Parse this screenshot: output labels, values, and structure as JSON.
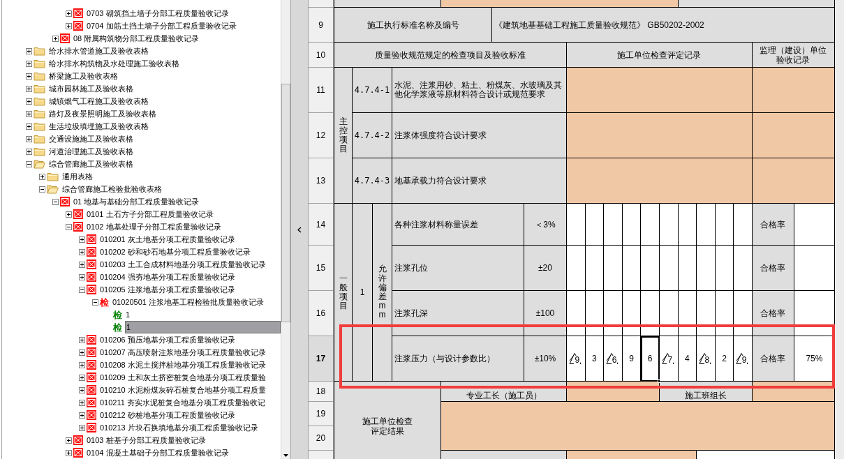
{
  "tree": [
    {
      "children": [
        {
          "children": [
            {
              "children": [
                {
                  "label": "0703 砌筑挡土墙子分部工程质量验收记录",
                  "kind": "form",
                  "expanded": false,
                  "selected": false
                },
                {
                  "label": "0704 加筋土挡土墙子分部工程质量验收记录",
                  "kind": "form",
                  "expanded": false,
                  "selected": false
                }
              ]
            },
            {
              "label": "08 附属构筑物分部工程质量验收记录",
              "kind": "form",
              "expanded": false,
              "selected": false
            }
          ]
        }
      ]
    },
    {
      "label": "给水排水管道施工及验收表格",
      "kind": "folder",
      "expanded": false,
      "selected": false
    },
    {
      "label": "给水排水构筑物及水处理施工验收表格",
      "kind": "folder",
      "expanded": false,
      "selected": false
    },
    {
      "label": "桥梁施工及验收表格",
      "kind": "folder",
      "expanded": false,
      "selected": false
    },
    {
      "label": "城市园林施工及验收表格",
      "kind": "folder",
      "expanded": false,
      "selected": false
    },
    {
      "label": "城镇燃气工程施工及验收表格",
      "kind": "folder",
      "expanded": false,
      "selected": false
    },
    {
      "label": "路灯及夜景照明施工及验收表格",
      "kind": "folder",
      "expanded": false,
      "selected": false
    },
    {
      "label": "生活垃圾填埋施工及验收表格",
      "kind": "folder",
      "expanded": false,
      "selected": false
    },
    {
      "label": "交通设施施工及验收表格",
      "kind": "folder",
      "expanded": false,
      "selected": false
    },
    {
      "label": "河道治理施工及验收表格",
      "kind": "folder",
      "expanded": false,
      "selected": false
    },
    {
      "label": "综合管廊施工及验收表格",
      "kind": "folder",
      "expanded": true,
      "selected": false,
      "children": [
        {
          "label": "通用表格",
          "kind": "folder",
          "expanded": false,
          "selected": false
        },
        {
          "label": "综合管廊施工检验批验收表格",
          "kind": "folder",
          "expanded": true,
          "selected": false,
          "children": [
            {
              "label": "01 地基与基础分部工程质量验收记录",
              "kind": "form",
              "expanded": true,
              "selected": false,
              "children": [
                {
                  "label": "0101 土石方子分部工程质量验收记录",
                  "kind": "form",
                  "expanded": false,
                  "selected": false
                },
                {
                  "label": "0102 地基处理子分部工程质量验收记录",
                  "kind": "form",
                  "expanded": true,
                  "selected": false,
                  "children": [
                    {
                      "label": "010201 灰土地基分项工程质量验收记录",
                      "kind": "form",
                      "expanded": false,
                      "selected": false
                    },
                    {
                      "label": "010202 砂和砂石地基分项工程质量验收记录",
                      "kind": "form",
                      "expanded": false,
                      "selected": false
                    },
                    {
                      "label": "010203 土工合成材料地基分项工程质量验收记录",
                      "kind": "form",
                      "expanded": false,
                      "selected": false
                    },
                    {
                      "label": "010204 强夯地基分项工程质量验收记录",
                      "kind": "form",
                      "expanded": false,
                      "selected": false
                    },
                    {
                      "label": "010205 注浆地基分项工程质量验收记录",
                      "kind": "form",
                      "expanded": true,
                      "selected": false,
                      "children": [
                        {
                          "label": "01020501 注浆地基工程检验批质量验收记录",
                          "kind": "check",
                          "badge": "检",
                          "color": "#ff0000",
                          "expanded": true,
                          "selected": false,
                          "children": [
                            {
                              "label": "1",
                              "kind": "check",
                              "badge": "检",
                              "color": "#008000",
                              "selected": false
                            },
                            {
                              "label": "1",
                              "kind": "check",
                              "badge": "检",
                              "color": "#008000",
                              "selected": true
                            }
                          ]
                        }
                      ]
                    },
                    {
                      "label": "010206 预压地基分项工程质量验收记录",
                      "kind": "form",
                      "expanded": false,
                      "selected": false
                    },
                    {
                      "label": "010207 高压喷射注浆地基分项工程质量验收记录",
                      "kind": "form",
                      "expanded": false,
                      "selected": false
                    },
                    {
                      "label": "010208 水泥土搅拌桩地基分项工程质量验收记录",
                      "kind": "form",
                      "expanded": false,
                      "selected": false
                    },
                    {
                      "label": "010209 土和灰土挤密桩复合地基分项工程质量验",
                      "kind": "form",
                      "expanded": false,
                      "selected": false
                    },
                    {
                      "label": "010210 水泥粉煤灰碎石桩复合地基分项工程质量",
                      "kind": "form",
                      "expanded": false,
                      "selected": false
                    },
                    {
                      "label": "010211 夯实水泥桩复合地基分项工程质量验收记",
                      "kind": "form",
                      "expanded": false,
                      "selected": false
                    },
                    {
                      "label": "010212 砂桩地基分项工程质量验收记录",
                      "kind": "form",
                      "expanded": false,
                      "selected": false
                    },
                    {
                      "label": "010213 片块石换填地基分项工程质量验收记录",
                      "kind": "form",
                      "expanded": false,
                      "selected": false
                    }
                  ]
                },
                {
                  "label": "0103 桩基子分部工程质量验收记录",
                  "kind": "form",
                  "expanded": false,
                  "selected": false
                },
                {
                  "label": "0104 混凝土基础子分部工程质量验收记录",
                  "kind": "form",
                  "expanded": false,
                  "selected": false
                }
              ]
            }
          ]
        }
      ]
    }
  ],
  "sheet": {
    "row_headers": [
      {
        "label": "9",
        "selected": false
      },
      {
        "label": "10",
        "selected": false
      },
      {
        "label": "11",
        "selected": false
      },
      {
        "label": "12",
        "selected": false
      },
      {
        "label": "13",
        "selected": false
      },
      {
        "label": "14",
        "selected": false
      },
      {
        "label": "15",
        "selected": false
      },
      {
        "label": "16",
        "selected": false
      },
      {
        "label": "17",
        "selected": true
      },
      {
        "label": "18",
        "selected": false
      },
      {
        "label": "19",
        "selected": false
      },
      {
        "label": "20",
        "selected": false
      }
    ],
    "cells": [
      {
        "kind": "label"
      },
      {
        "kind": "input"
      },
      {
        "kind": "label"
      },
      {
        "text": "施工执行标准名称及编号",
        "kind": "label"
      },
      {
        "text": "《建筑地基基础工程施工质量验收规范》 GB50202-2002",
        "kind": "label"
      },
      {
        "text": "质量验收规范规定的检查项目及验收标准",
        "kind": "label"
      },
      {
        "text": "施工单位检查评定记录",
        "kind": "label"
      },
      {
        "text": "监理（建设）单位验收记录",
        "kind": "label"
      },
      {
        "text": "主控项目",
        "kind": "label"
      },
      {
        "text": "4.7.4-1",
        "kind": "label"
      },
      {
        "text": "水泥、注浆用砂、粘土、粉煤灰、水玻璃及其他化学浆液等原材料符合设计或规范要求",
        "kind": "label"
      },
      {
        "kind": "input"
      },
      {
        "kind": "input"
      },
      {
        "text": "4.7.4-2",
        "kind": "label"
      },
      {
        "text": "注浆体强度符合设计要求",
        "kind": "label"
      },
      {
        "kind": "input"
      },
      {
        "kind": "input"
      },
      {
        "text": "4.7.4-3",
        "kind": "label"
      },
      {
        "text": "地基承载力符合设计要求",
        "kind": "label"
      },
      {
        "kind": "input"
      },
      {
        "kind": "input"
      },
      {
        "text": "一般项目",
        "kind": "label"
      },
      {
        "text": "1",
        "kind": "label"
      },
      {
        "text": "允许偏差mm",
        "kind": "label"
      },
      {
        "text": "各种注浆材料称量误差",
        "kind": "label"
      },
      {
        "text": "＜3%",
        "kind": "label"
      },
      {
        "text": "合格率",
        "kind": "label"
      },
      {
        "kind": "blank"
      },
      {
        "text": "注浆孔位",
        "kind": "label"
      },
      {
        "text": "±20",
        "kind": "label"
      },
      {
        "text": "合格率",
        "kind": "label"
      },
      {
        "kind": "blank"
      },
      {
        "text": "注浆孔深",
        "kind": "label"
      },
      {
        "text": "±100",
        "kind": "label"
      },
      {
        "text": "合格率",
        "kind": "label"
      },
      {
        "kind": "blank"
      },
      {
        "text": "注浆压力（与设计参数比）",
        "kind": "label"
      },
      {
        "text": "±10%",
        "kind": "label"
      },
      {
        "text": "合格率",
        "kind": "label"
      },
      {
        "text": "75%",
        "kind": "blank"
      },
      {
        "text": "施工单位检查评定结果",
        "kind": "label"
      },
      {
        "text": "专业工长（施工员）",
        "kind": "label"
      },
      {
        "kind": "input"
      },
      {
        "text": "施工班组长",
        "kind": "label"
      },
      {
        "kind": "input"
      },
      {
        "kind": "input"
      },
      {
        "kind": "label"
      },
      {
        "kind": "input"
      },
      {
        "kind": "blank"
      }
    ],
    "measurements": [
      {
        "value": "9",
        "flagged": true,
        "selected": false
      },
      {
        "value": "3",
        "flagged": false,
        "selected": false
      },
      {
        "value": "6",
        "flagged": true,
        "selected": false
      },
      {
        "value": "9",
        "flagged": false,
        "selected": false
      },
      {
        "value": "6",
        "flagged": false,
        "selected": true
      },
      {
        "value": "7",
        "flagged": true,
        "selected": false
      },
      {
        "value": "4",
        "flagged": false,
        "selected": false
      },
      {
        "value": "8",
        "flagged": true,
        "selected": false
      },
      {
        "value": "2",
        "flagged": false,
        "selected": false
      },
      {
        "value": "9",
        "flagged": true,
        "selected": false
      }
    ]
  }
}
